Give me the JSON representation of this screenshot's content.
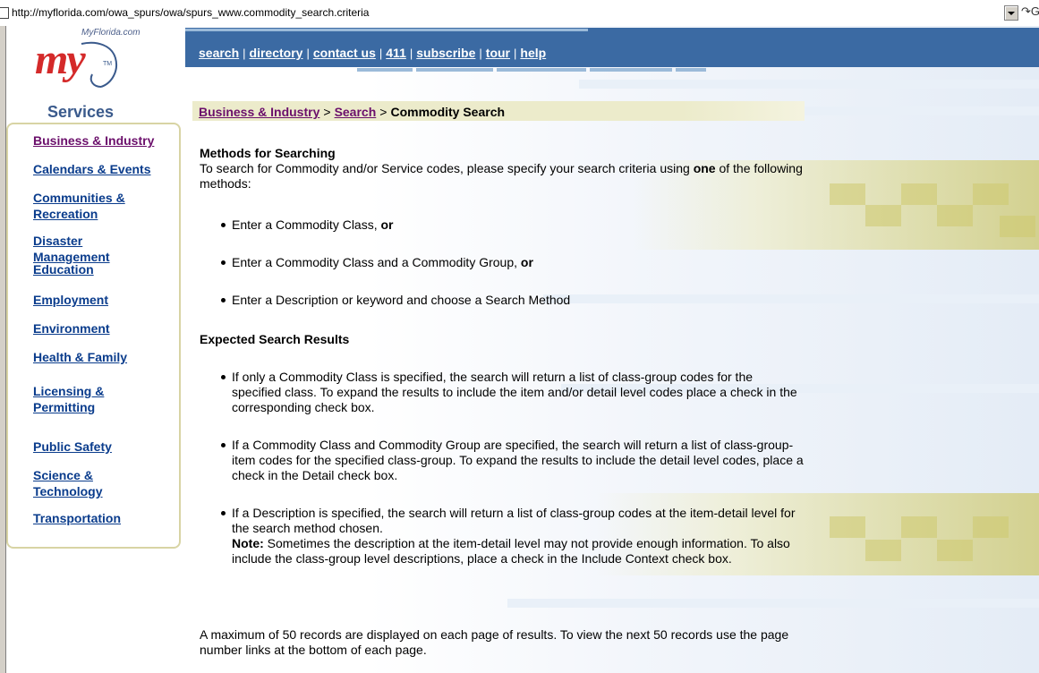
{
  "browser": {
    "address": "http://myflorida.com/owa_spurs/owa/spurs_www.commodity_search.criteria",
    "go_label": "G"
  },
  "logo": {
    "caption": "MyFlorida.com",
    "wordmark": "my",
    "trademark": "TM"
  },
  "services": {
    "title": "Services",
    "items": [
      "Business & Industry",
      "Calendars & Events",
      "Communities &\nRecreation",
      "Disaster\nManagement",
      "Education",
      "Employment",
      "Environment",
      "Health & Family",
      "Licensing &\nPermitting",
      "Public Safety",
      "Science &\nTechnology",
      "Transportation"
    ]
  },
  "topnav": {
    "items": [
      "search",
      "directory",
      "contact us",
      "411",
      "subscribe",
      "tour",
      "help"
    ],
    "separator": "|"
  },
  "breadcrumb": {
    "items": [
      "Business & Industry",
      "Search"
    ],
    "current": "Commodity Search",
    "separator": ">"
  },
  "content": {
    "methods_heading": "Methods for Searching",
    "methods_intro_before": "To search for Commodity and/or Service codes, please specify your search criteria using ",
    "methods_intro_bold": "one",
    "methods_intro_after": " of the following methods:",
    "methods": [
      {
        "text": "Enter a Commodity Class, ",
        "bold": "or"
      },
      {
        "text": "Enter a Commodity Class and a Commodity Group, ",
        "bold": "or"
      },
      {
        "text": "Enter a Description or keyword and choose a Search Method",
        "bold": ""
      }
    ],
    "results_heading": "Expected Search Results",
    "results": [
      "If only a Commodity Class is specified, the search will return a list of class-group codes for the specified class. To expand the results to include the item and/or detail level codes place a check in the corresponding check box.",
      "If a Commodity Class and Commodity Group are specified, the search will return a list of class-group-item codes for the specified class-group. To expand the results to include the detail level codes, place a check in the Detail check box.",
      "If a Description is specified, the search will return a list of class-group codes at the item-detail level for the search method chosen."
    ],
    "note_label": "Note:",
    "note_text": " Sometimes the description at the item-detail level may not provide enough information. To also include the class-group level descriptions, place a check in the Include Context check box.",
    "footer": "A maximum of 50 records are displayed on each page of results. To view the next 50 records use the page number links at the bottom of each page."
  },
  "colors": {
    "nav_bar": "#3b6aa3",
    "link": "#0a3c8c",
    "visited_link": "#6b0f6b",
    "logo_red": "#d42a2a",
    "breadcrumb_bg": "#ecebcb"
  }
}
